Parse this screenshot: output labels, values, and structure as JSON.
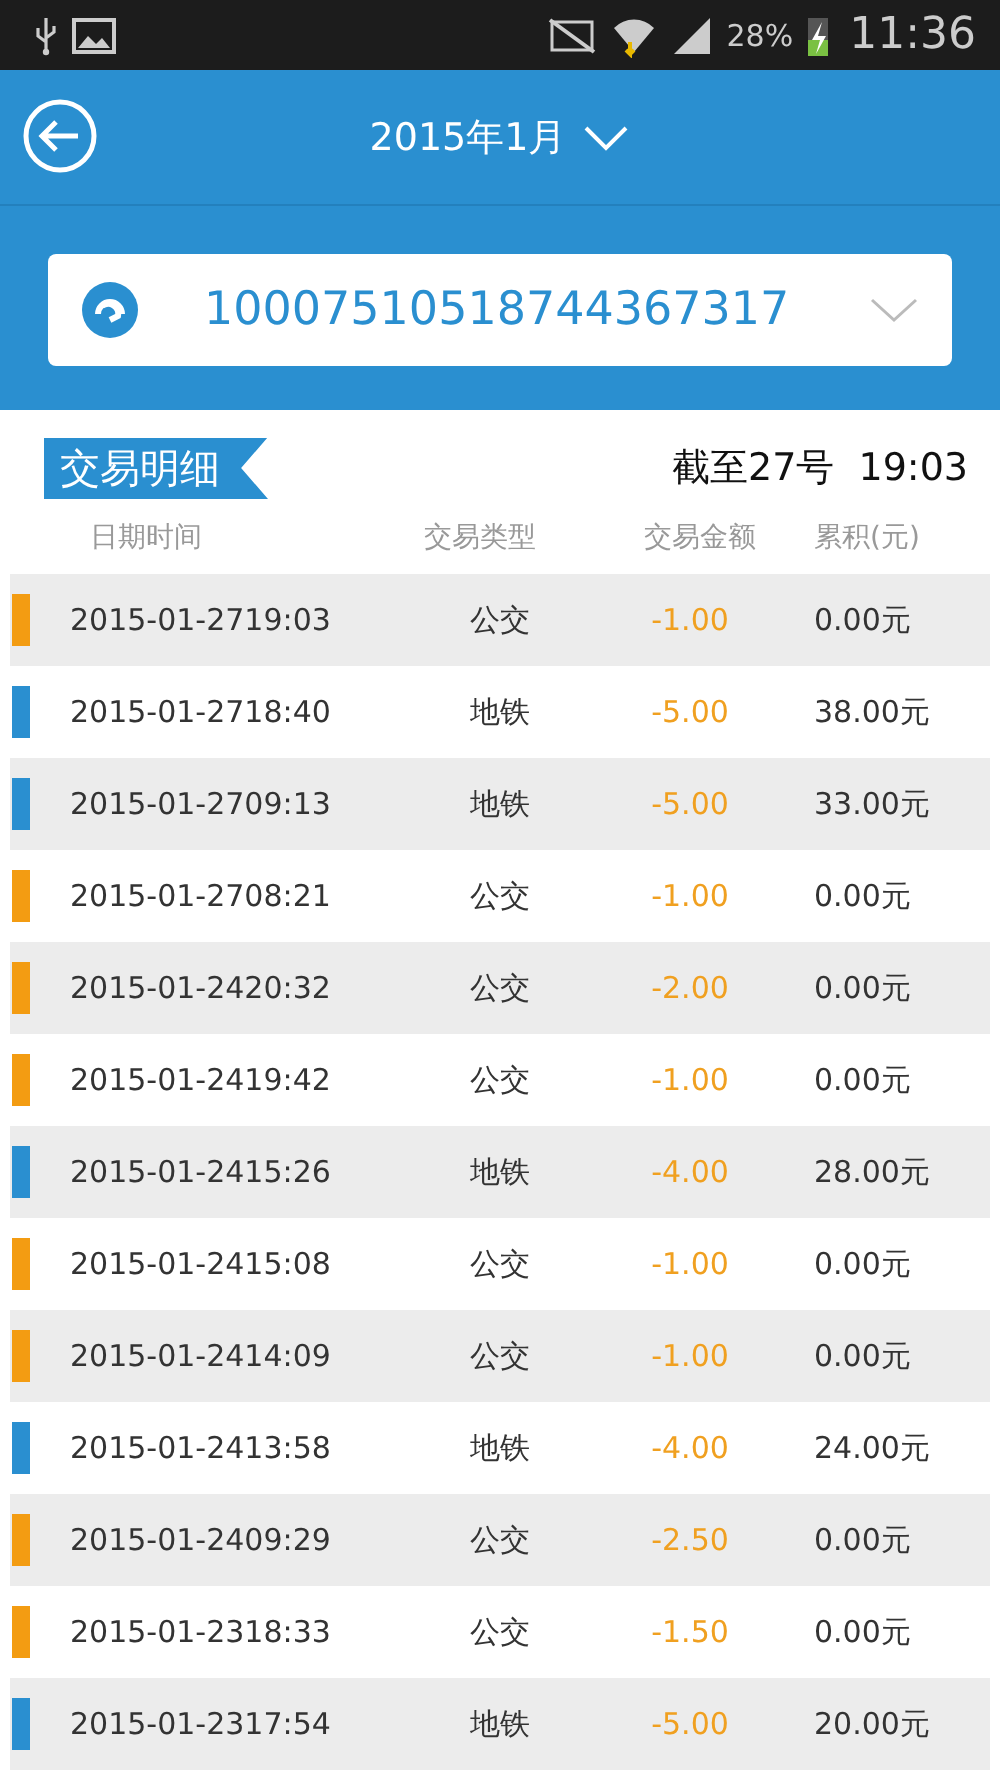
{
  "status_bar": {
    "battery": "28%",
    "time": "11:36"
  },
  "header": {
    "month": "2015年1月"
  },
  "card": {
    "number": "10007510518744367317"
  },
  "section": {
    "title": "交易明细",
    "as_of": "截至27号  19:03"
  },
  "table": {
    "columns": [
      "日期时间",
      "交易类型",
      "交易金额",
      "累积(元)"
    ],
    "rows": [
      {
        "time": "2015-01-2719:03",
        "type": "公交",
        "amount": "-1.00",
        "balance": "0.00元",
        "color": "#f39c12"
      },
      {
        "time": "2015-01-2718:40",
        "type": "地铁",
        "amount": "-5.00",
        "balance": "38.00元",
        "color": "#2a8fd0"
      },
      {
        "time": "2015-01-2709:13",
        "type": "地铁",
        "amount": "-5.00",
        "balance": "33.00元",
        "color": "#2a8fd0"
      },
      {
        "time": "2015-01-2708:21",
        "type": "公交",
        "amount": "-1.00",
        "balance": "0.00元",
        "color": "#f39c12"
      },
      {
        "time": "2015-01-2420:32",
        "type": "公交",
        "amount": "-2.00",
        "balance": "0.00元",
        "color": "#f39c12"
      },
      {
        "time": "2015-01-2419:42",
        "type": "公交",
        "amount": "-1.00",
        "balance": "0.00元",
        "color": "#f39c12"
      },
      {
        "time": "2015-01-2415:26",
        "type": "地铁",
        "amount": "-4.00",
        "balance": "28.00元",
        "color": "#2a8fd0"
      },
      {
        "time": "2015-01-2415:08",
        "type": "公交",
        "amount": "-1.00",
        "balance": "0.00元",
        "color": "#f39c12"
      },
      {
        "time": "2015-01-2414:09",
        "type": "公交",
        "amount": "-1.00",
        "balance": "0.00元",
        "color": "#f39c12"
      },
      {
        "time": "2015-01-2413:58",
        "type": "地铁",
        "amount": "-4.00",
        "balance": "24.00元",
        "color": "#2a8fd0"
      },
      {
        "time": "2015-01-2409:29",
        "type": "公交",
        "amount": "-2.50",
        "balance": "0.00元",
        "color": "#f39c12"
      },
      {
        "time": "2015-01-2318:33",
        "type": "公交",
        "amount": "-1.50",
        "balance": "0.00元",
        "color": "#f39c12"
      },
      {
        "time": "2015-01-2317:54",
        "type": "地铁",
        "amount": "-5.00",
        "balance": "20.00元",
        "color": "#2a8fd0"
      }
    ]
  }
}
